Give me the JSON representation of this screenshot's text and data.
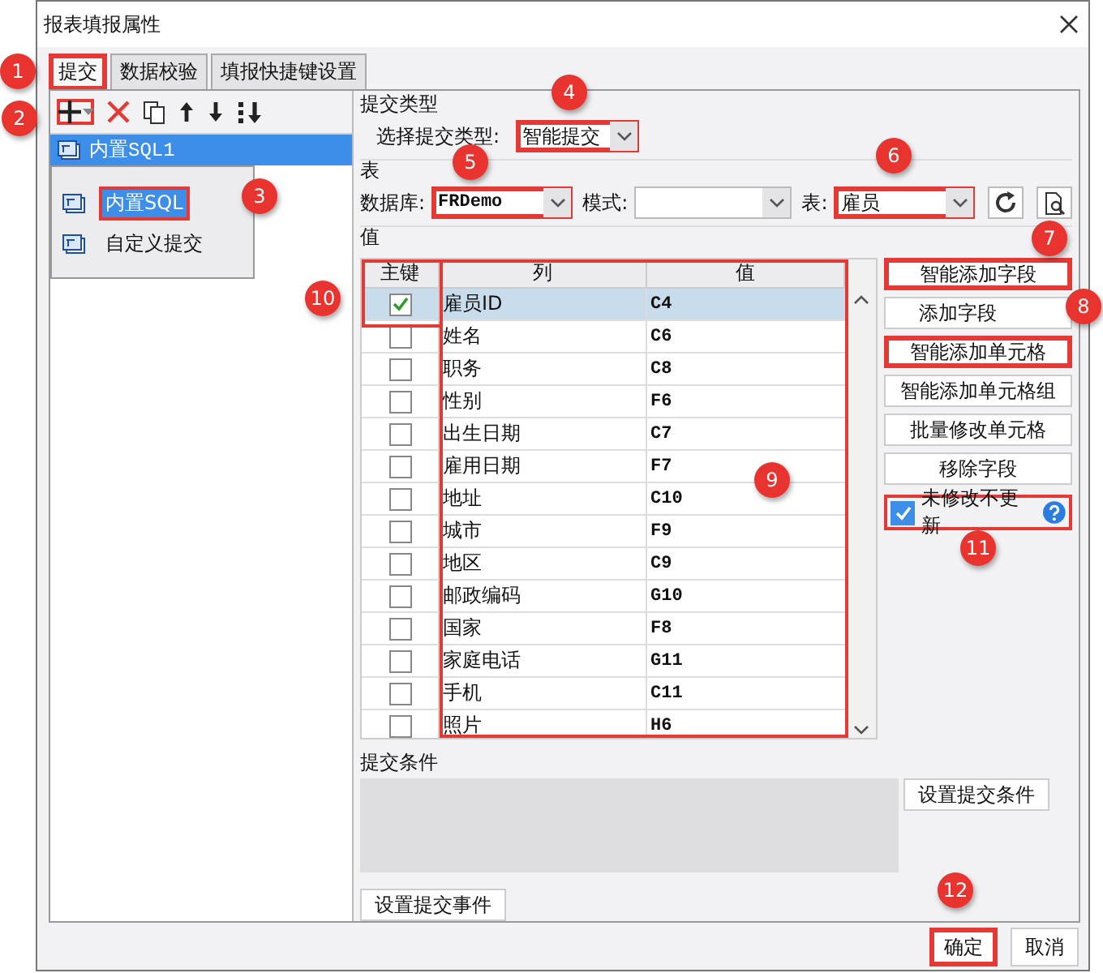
{
  "window": {
    "title": "报表填报属性"
  },
  "tabs": [
    {
      "label": "提交",
      "selected": true,
      "highlighted": true
    },
    {
      "label": "数据校验",
      "selected": false,
      "highlighted": false
    },
    {
      "label": "填报快捷键设置",
      "selected": false,
      "highlighted": false
    }
  ],
  "toolbar": {
    "add_highlighted": true
  },
  "tree": {
    "items": [
      {
        "label": "内置SQL1",
        "selected": true
      }
    ]
  },
  "add_menu": {
    "items": [
      {
        "label": "内置SQL",
        "selected": true,
        "highlighted": true
      },
      {
        "label": "自定义提交",
        "selected": false,
        "highlighted": false
      }
    ]
  },
  "submit_type": {
    "heading": "提交类型",
    "label": "选择提交类型:",
    "value": "智能提交",
    "highlighted": true
  },
  "table_section": {
    "heading": "表",
    "database": {
      "label": "数据库:",
      "value": "FRDemo",
      "highlighted": true
    },
    "schema": {
      "label": "模式:"
    },
    "table": {
      "label": "表:",
      "value": "雇员",
      "highlighted": true
    }
  },
  "values": {
    "heading": "值",
    "key_highlighted": true,
    "mapping_highlighted": true,
    "columns": [
      "主键",
      "列",
      "值"
    ],
    "rows": [
      {
        "column": "雇员ID",
        "value": "C4",
        "key": true,
        "selected": true
      },
      {
        "column": "姓名",
        "value": "C6",
        "key": false,
        "selected": false
      },
      {
        "column": "职务",
        "value": "C8",
        "key": false,
        "selected": false
      },
      {
        "column": "性别",
        "value": "F6",
        "key": false,
        "selected": false
      },
      {
        "column": "出生日期",
        "value": "C7",
        "key": false,
        "selected": false
      },
      {
        "column": "雇用日期",
        "value": "F7",
        "key": false,
        "selected": false
      },
      {
        "column": "地址",
        "value": "C10",
        "key": false,
        "selected": false
      },
      {
        "column": "城市",
        "value": "F9",
        "key": false,
        "selected": false
      },
      {
        "column": "地区",
        "value": "C9",
        "key": false,
        "selected": false
      },
      {
        "column": "邮政编码",
        "value": "G10",
        "key": false,
        "selected": false
      },
      {
        "column": "国家",
        "value": "F8",
        "key": false,
        "selected": false
      },
      {
        "column": "家庭电话",
        "value": "G11",
        "key": false,
        "selected": false
      },
      {
        "column": "手机",
        "value": "C11",
        "key": false,
        "selected": false
      },
      {
        "column": "照片",
        "value": "H6",
        "key": false,
        "selected": false
      }
    ]
  },
  "actions": [
    {
      "label": "智能添加字段",
      "highlighted": true
    },
    {
      "label": "添加字段",
      "highlighted": false
    },
    {
      "label": "智能添加单元格",
      "highlighted": true
    },
    {
      "label": "智能添加单元格组",
      "highlighted": false
    },
    {
      "label": "批量修改单元格",
      "highlighted": false
    },
    {
      "label": "移除字段",
      "highlighted": false
    }
  ],
  "skip_unchanged": {
    "label": "未修改不更新",
    "checked": true,
    "highlighted": true
  },
  "condition": {
    "heading": "提交条件",
    "button": "设置提交条件"
  },
  "event_button": "设置提交事件",
  "dialog_buttons": [
    {
      "label": "确定",
      "highlighted": true
    },
    {
      "label": "取消",
      "highlighted": false
    }
  ],
  "callouts": [
    "1",
    "2",
    "3",
    "4",
    "5",
    "6",
    "7",
    "8",
    "9",
    "10",
    "11",
    "12"
  ]
}
